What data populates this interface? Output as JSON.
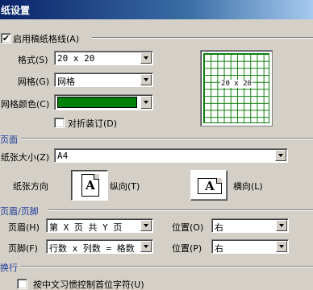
{
  "window": {
    "title": "纸设置"
  },
  "grid_settings": {
    "enable_label": "启用稿纸格线(A)",
    "enable_checked": true,
    "style_label": "格式(S)",
    "style_value": "20 x 20",
    "grid_label": "网格(G)",
    "grid_value": "网格",
    "color_label": "网格颜色(C)",
    "color_value": "#00800b",
    "fold_label": "对折装订(D)",
    "fold_checked": false,
    "preview_text": "20 x 20"
  },
  "page": {
    "section_title": "页面",
    "size_label": "纸张大小(Z)",
    "size_value": "A4",
    "orientation_label": "纸张方向",
    "portrait_label": "纵向(T)",
    "landscape_label": "横向(L)",
    "portrait_glyph": "A",
    "landscape_glyph": "A"
  },
  "header_footer": {
    "section_title": "页眉/页脚",
    "header_label": "页眉(H)",
    "header_value": "第 X 页 共 Y 页",
    "header_pos_label": "位置(O)",
    "header_pos_value": "右",
    "footer_label": "页脚(F)",
    "footer_value": "行数 x 列数 = 格数",
    "footer_pos_label": "位置(P)",
    "footer_pos_value": "右"
  },
  "line_break": {
    "section_title": "换行",
    "chinese_control_label": "按中文习惯控制首位字符(U)",
    "chinese_control_checked": false
  }
}
